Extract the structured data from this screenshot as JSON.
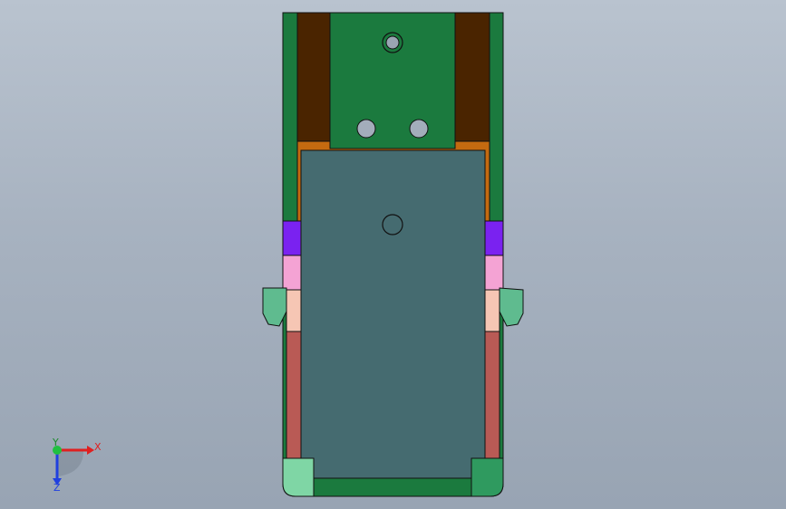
{
  "viewport": {
    "background_top": "#b9c3cf",
    "background_bottom": "#98a4b3"
  },
  "model": {
    "parts": [
      {
        "name": "outer-housing",
        "color": "#1b7a3e"
      },
      {
        "name": "left-rail",
        "color": "#4a2400"
      },
      {
        "name": "right-rail",
        "color": "#4a2400"
      },
      {
        "name": "top-block",
        "color": "#1b7a3e"
      },
      {
        "name": "bracket-orange",
        "color": "#c46a10"
      },
      {
        "name": "center-slide",
        "color": "#456b70"
      },
      {
        "name": "purple-spacer",
        "color": "#7a22f0"
      },
      {
        "name": "pink-spacer",
        "color": "#f4a3d4"
      },
      {
        "name": "peach-spacer",
        "color": "#f6c6b4"
      },
      {
        "name": "red-guide",
        "color": "#b95a55"
      },
      {
        "name": "side-clip",
        "color": "#5fbb8f"
      },
      {
        "name": "base-light",
        "color": "#7fd6a5"
      },
      {
        "name": "base-mid",
        "color": "#1b7a3e"
      },
      {
        "name": "base-right",
        "color": "#2f9a5f"
      }
    ],
    "edge_color": "#111111"
  },
  "triad": {
    "x_label": "X",
    "y_label": "Y",
    "z_label": "Z",
    "x_color": "#e02020",
    "y_color": "#20c040",
    "z_color": "#2040e0"
  }
}
